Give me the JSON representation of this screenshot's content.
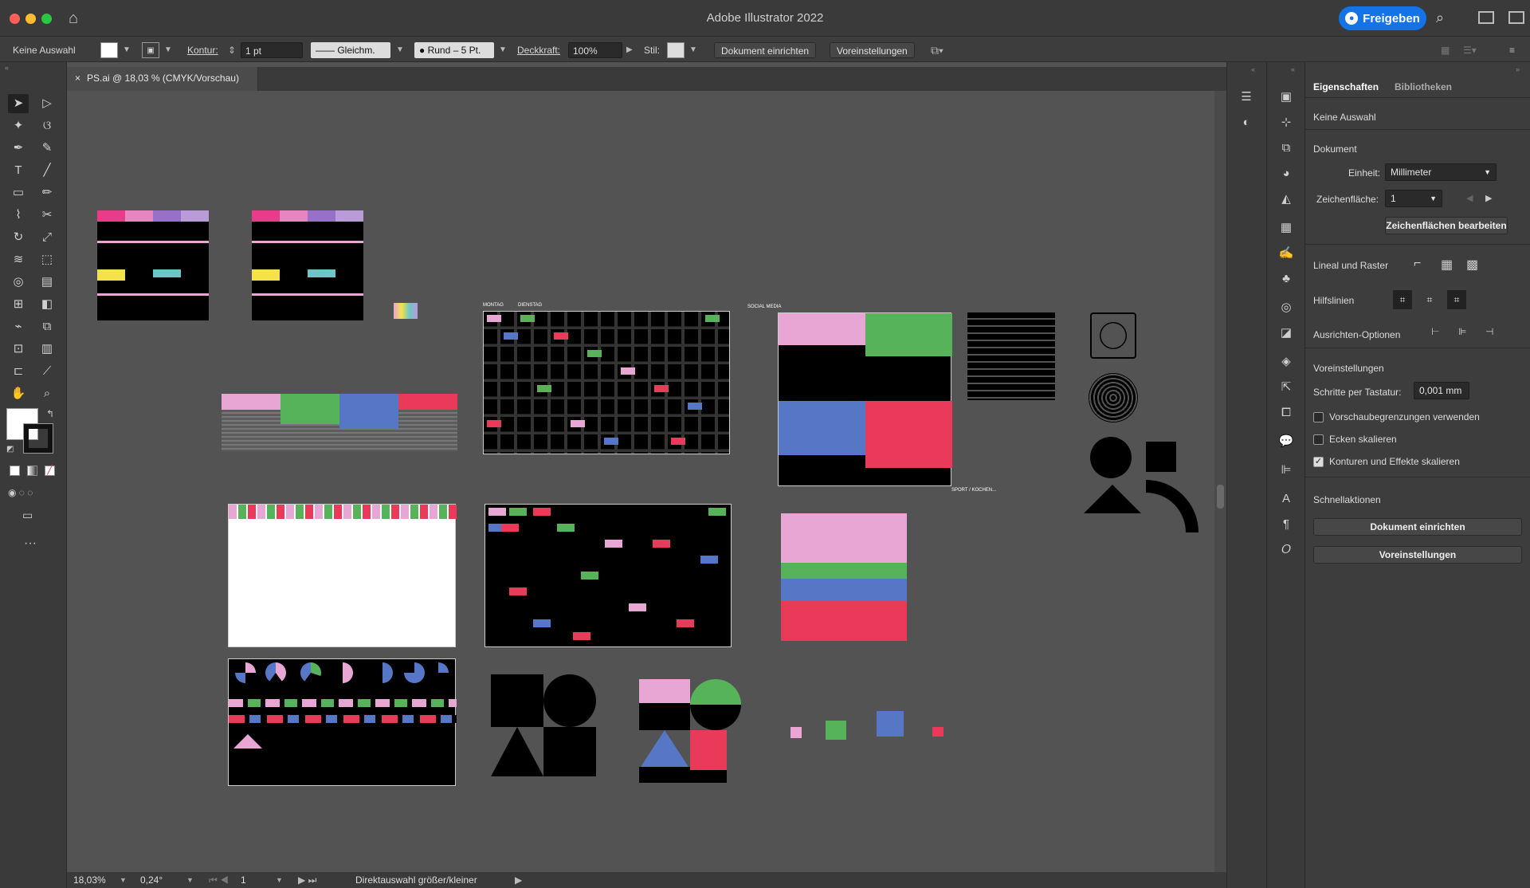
{
  "window": {
    "title": "Adobe Illustrator 2022",
    "share_label": "Freigeben"
  },
  "control_bar": {
    "selection": "Keine Auswahl",
    "stroke_label": "Kontur:",
    "stroke_value": "1 pt",
    "stroke_profile": "Gleichm.",
    "brush": "Rund – 5 Pt.",
    "opacity_label": "Deckkraft:",
    "opacity_value": "100%",
    "style_label": "Stil:",
    "doc_setup_button": "Dokument einrichten",
    "prefs_button": "Voreinstellungen"
  },
  "document_tab": {
    "title": "PS.ai @ 18,03 % (CMYK/Vorschau)"
  },
  "status_bar": {
    "zoom": "18,03%",
    "rotation": "0,24°",
    "artboard": "1",
    "tool_hint": "Direktauswahl größer/kleiner"
  },
  "properties_panel": {
    "tabs": [
      "Eigenschaften",
      "Bibliotheken"
    ],
    "selection": "Keine Auswahl",
    "document_heading": "Dokument",
    "unit_label": "Einheit:",
    "unit_value": "Millimeter",
    "artboard_label": "Zeichenfläche:",
    "artboard_value": "1",
    "edit_artboards_button": "Zeichenflächen bearbeiten",
    "rulers_label": "Lineal und Raster",
    "guides_label": "Hilfslinien",
    "align_label": "Ausrichten-Optionen",
    "prefs_heading": "Voreinstellungen",
    "keyboard_increment_label": "Schritte per Tastatur:",
    "keyboard_increment_value": "0,001 mm",
    "checkboxes": [
      {
        "label": "Vorschaubegrenzungen verwenden",
        "checked": false
      },
      {
        "label": "Ecken skalieren",
        "checked": false
      },
      {
        "label": "Konturen und Effekte skalieren",
        "checked": true
      }
    ],
    "quick_actions_heading": "Schnellaktionen",
    "quick_doc_setup_button": "Dokument einrichten",
    "quick_prefs_button": "Voreinstellungen"
  },
  "canvas_labels": {
    "day_monday": "MONTAG",
    "day_tuesday": "DIENSTAG",
    "social_media": "SOCIAL MEDIA",
    "sport": "SPORT / KOCHEN..."
  },
  "colors": {
    "pink": "#e7a6d4",
    "green": "#57b35a",
    "blue": "#5577c6",
    "red": "#ea3a5a",
    "accent": "#1473e6"
  }
}
